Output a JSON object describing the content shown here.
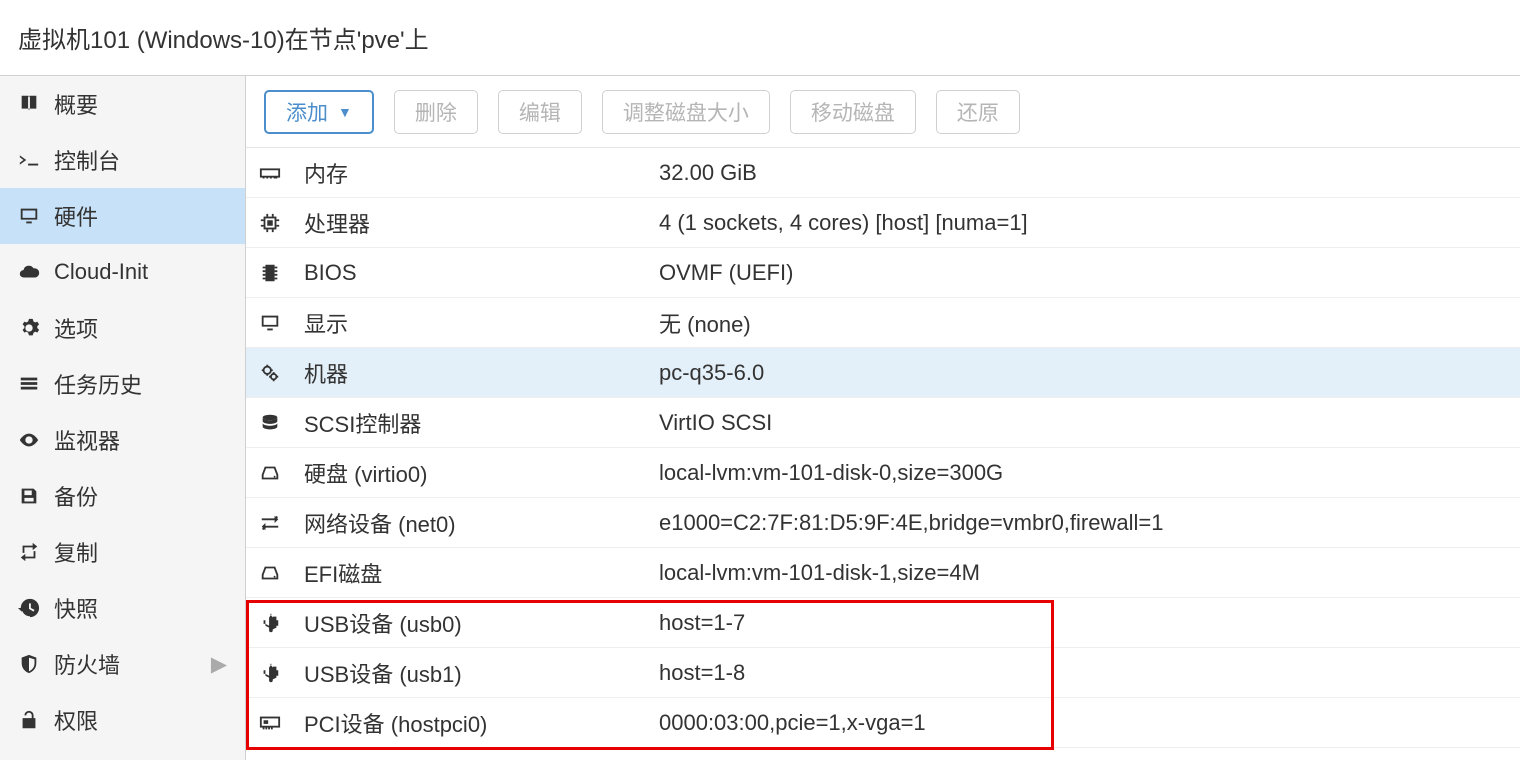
{
  "header": {
    "title": "虚拟机101 (Windows-10)在节点'pve'上"
  },
  "sidebar": {
    "items": [
      {
        "label": "概要",
        "icon": "book",
        "active": false
      },
      {
        "label": "控制台",
        "icon": "terminal",
        "active": false
      },
      {
        "label": "硬件",
        "icon": "monitor",
        "active": true
      },
      {
        "label": "Cloud-Init",
        "icon": "cloud",
        "active": false
      },
      {
        "label": "选项",
        "icon": "gear",
        "active": false
      },
      {
        "label": "任务历史",
        "icon": "list",
        "active": false
      },
      {
        "label": "监视器",
        "icon": "eye",
        "active": false
      },
      {
        "label": "备份",
        "icon": "save",
        "active": false
      },
      {
        "label": "复制",
        "icon": "retweet",
        "active": false
      },
      {
        "label": "快照",
        "icon": "history",
        "active": false
      },
      {
        "label": "防火墙",
        "icon": "shield",
        "active": false,
        "chevron": true
      },
      {
        "label": "权限",
        "icon": "unlock",
        "active": false
      }
    ]
  },
  "toolbar": {
    "add": "添加",
    "delete": "删除",
    "edit": "编辑",
    "resize": "调整磁盘大小",
    "move": "移动磁盘",
    "restore": "还原"
  },
  "hardware": [
    {
      "icon": "memory",
      "label": "内存",
      "value": "32.00 GiB"
    },
    {
      "icon": "cpu",
      "label": "处理器",
      "value": "4 (1 sockets, 4 cores) [host] [numa=1]"
    },
    {
      "icon": "chip",
      "label": "BIOS",
      "value": "OVMF (UEFI)"
    },
    {
      "icon": "monitor",
      "label": "显示",
      "value": "无 (none)"
    },
    {
      "icon": "gears",
      "label": "机器",
      "value": "pc-q35-6.0",
      "highlight": true
    },
    {
      "icon": "stack",
      "label": "SCSI控制器",
      "value": "VirtIO SCSI"
    },
    {
      "icon": "hdd",
      "label": "硬盘 (virtio0)",
      "value": "local-lvm:vm-101-disk-0,size=300G"
    },
    {
      "icon": "net",
      "label": "网络设备 (net0)",
      "value": "e1000=C2:7F:81:D5:9F:4E,bridge=vmbr0,firewall=1"
    },
    {
      "icon": "hdd",
      "label": "EFI磁盘",
      "value": "local-lvm:vm-101-disk-1,size=4M"
    },
    {
      "icon": "usb",
      "label": "USB设备 (usb0)",
      "value": "host=1-7"
    },
    {
      "icon": "usb",
      "label": "USB设备 (usb1)",
      "value": "host=1-8"
    },
    {
      "icon": "pci",
      "label": "PCI设备 (hostpci0)",
      "value": "0000:03:00,pcie=1,x-vga=1"
    }
  ]
}
